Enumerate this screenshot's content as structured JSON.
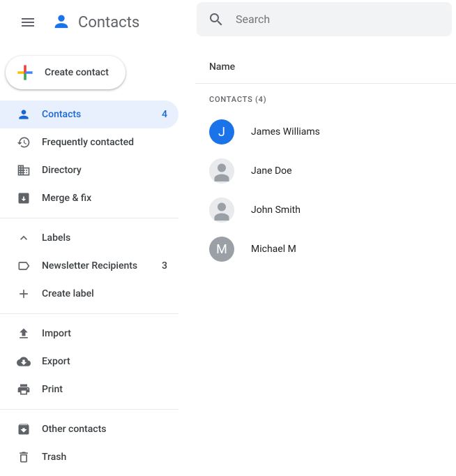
{
  "header": {
    "app_name": "Contacts",
    "search_placeholder": "Search"
  },
  "create_button": {
    "label": "Create contact"
  },
  "sidebar": {
    "nav": [
      {
        "label": "Contacts",
        "count": "4",
        "active": true
      },
      {
        "label": "Frequently contacted"
      },
      {
        "label": "Directory"
      },
      {
        "label": "Merge & fix"
      }
    ],
    "labels_header": "Labels",
    "labels": [
      {
        "label": "Newsletter Recipients",
        "count": "3"
      }
    ],
    "create_label": "Create label",
    "tools": [
      {
        "label": "Import"
      },
      {
        "label": "Export"
      },
      {
        "label": "Print"
      }
    ],
    "other": [
      {
        "label": "Other contacts"
      },
      {
        "label": "Trash"
      }
    ]
  },
  "content": {
    "column_header": "Name",
    "section_label": "Contacts (4)",
    "contacts": [
      {
        "name": "James Williams",
        "initial": "J",
        "color": "#1a73e8",
        "type": "initial"
      },
      {
        "name": "Jane Doe",
        "type": "img"
      },
      {
        "name": "John Smith",
        "type": "img"
      },
      {
        "name": "Michael M",
        "initial": "M",
        "color": "#9aa0a6",
        "type": "initial"
      }
    ]
  }
}
